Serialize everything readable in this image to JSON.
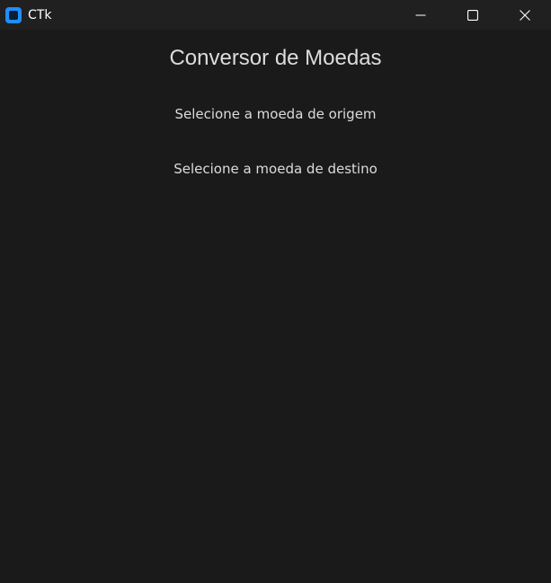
{
  "window": {
    "title": "CTk",
    "icon": "ctk-app-icon",
    "controls": {
      "minimize": "minimize-icon",
      "maximize": "maximize-icon",
      "close": "close-icon"
    }
  },
  "main": {
    "heading": "Conversor de Moedas",
    "origin_label": "Selecione a moeda de origem",
    "destination_label": "Selecione a moeda de destino"
  },
  "colors": {
    "background": "#1a1a1a",
    "titlebar": "#202020",
    "text": "#dcdcdc",
    "icon_accent": "#1f8fff"
  }
}
